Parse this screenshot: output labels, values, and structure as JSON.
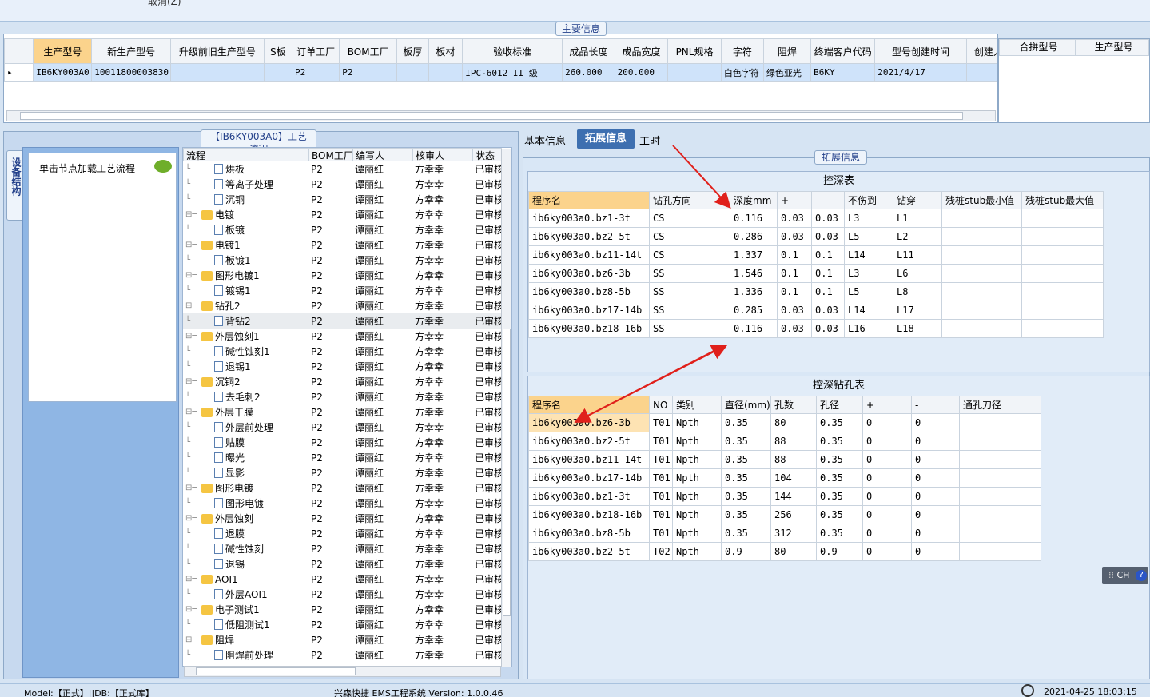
{
  "toolbar": {
    "cancel_label": "取消(Z)"
  },
  "main_info": {
    "title": "主要信息",
    "columns": [
      "生产型号",
      "新生产型号",
      "升级前旧生产型号",
      "S板",
      "订单工厂",
      "BOM工厂",
      "板厚",
      "板材",
      "验收标准",
      "成品长度",
      "成品宽度",
      "PNL规格",
      "字符",
      "阻焊",
      "终端客户代码",
      "型号创建时间",
      "创建人"
    ],
    "row": [
      "IB6KY003A0",
      "10011800003830",
      "",
      "",
      "P2",
      "P2",
      "",
      "",
      "IPC-6012 II 级",
      "260.000",
      "200.000",
      "",
      "白色字符",
      "绿色亚光",
      "B6KY",
      "2021/4/17",
      ""
    ]
  },
  "merge_panel": {
    "columns": [
      "合拼型号",
      "生产型号"
    ]
  },
  "flow_panel": {
    "title": "【IB6KY003A0】工艺流程",
    "side_tab": "设备结构",
    "hint": "单击节点加载工艺流程",
    "columns": [
      "流程",
      "BOM工厂",
      "编写人",
      "核审人",
      "状态"
    ],
    "rows": [
      {
        "name": "烘板",
        "level": 2,
        "bom": "P2",
        "writer": "谭丽红",
        "reviewer": "方幸幸",
        "status": "已审核"
      },
      {
        "name": "等离子处理",
        "level": 2,
        "bom": "P2",
        "writer": "谭丽红",
        "reviewer": "方幸幸",
        "status": "已审核"
      },
      {
        "name": "沉铜",
        "level": 2,
        "bom": "P2",
        "writer": "谭丽红",
        "reviewer": "方幸幸",
        "status": "已审核"
      },
      {
        "name": "电镀",
        "level": 1,
        "bom": "P2",
        "writer": "谭丽红",
        "reviewer": "方幸幸",
        "status": "已审核"
      },
      {
        "name": "板镀",
        "level": 2,
        "bom": "P2",
        "writer": "谭丽红",
        "reviewer": "方幸幸",
        "status": "已审核"
      },
      {
        "name": "电镀1",
        "level": 1,
        "bom": "P2",
        "writer": "谭丽红",
        "reviewer": "方幸幸",
        "status": "已审核"
      },
      {
        "name": "板镀1",
        "level": 2,
        "bom": "P2",
        "writer": "谭丽红",
        "reviewer": "方幸幸",
        "status": "已审核"
      },
      {
        "name": "图形电镀1",
        "level": 1,
        "bom": "P2",
        "writer": "谭丽红",
        "reviewer": "方幸幸",
        "status": "已审核"
      },
      {
        "name": "镀锡1",
        "level": 2,
        "bom": "P2",
        "writer": "谭丽红",
        "reviewer": "方幸幸",
        "status": "已审核"
      },
      {
        "name": "钻孔2",
        "level": 1,
        "bom": "P2",
        "writer": "谭丽红",
        "reviewer": "方幸幸",
        "status": "已审核"
      },
      {
        "name": "背钻2",
        "level": 2,
        "bom": "P2",
        "writer": "谭丽红",
        "reviewer": "方幸幸",
        "status": "已审核",
        "selected": true
      },
      {
        "name": "外层蚀刻1",
        "level": 1,
        "bom": "P2",
        "writer": "谭丽红",
        "reviewer": "方幸幸",
        "status": "已审核"
      },
      {
        "name": "碱性蚀刻1",
        "level": 2,
        "bom": "P2",
        "writer": "谭丽红",
        "reviewer": "方幸幸",
        "status": "已审核"
      },
      {
        "name": "退锡1",
        "level": 2,
        "bom": "P2",
        "writer": "谭丽红",
        "reviewer": "方幸幸",
        "status": "已审核"
      },
      {
        "name": "沉铜2",
        "level": 1,
        "bom": "P2",
        "writer": "谭丽红",
        "reviewer": "方幸幸",
        "status": "已审核"
      },
      {
        "name": "去毛刺2",
        "level": 2,
        "bom": "P2",
        "writer": "谭丽红",
        "reviewer": "方幸幸",
        "status": "已审核"
      },
      {
        "name": "外层干膜",
        "level": 1,
        "bom": "P2",
        "writer": "谭丽红",
        "reviewer": "方幸幸",
        "status": "已审核"
      },
      {
        "name": "外层前处理",
        "level": 2,
        "bom": "P2",
        "writer": "谭丽红",
        "reviewer": "方幸幸",
        "status": "已审核"
      },
      {
        "name": "贴膜",
        "level": 2,
        "bom": "P2",
        "writer": "谭丽红",
        "reviewer": "方幸幸",
        "status": "已审核"
      },
      {
        "name": "曝光",
        "level": 2,
        "bom": "P2",
        "writer": "谭丽红",
        "reviewer": "方幸幸",
        "status": "已审核"
      },
      {
        "name": "显影",
        "level": 2,
        "bom": "P2",
        "writer": "谭丽红",
        "reviewer": "方幸幸",
        "status": "已审核"
      },
      {
        "name": "图形电镀",
        "level": 1,
        "bom": "P2",
        "writer": "谭丽红",
        "reviewer": "方幸幸",
        "status": "已审核"
      },
      {
        "name": "图形电镀",
        "level": 2,
        "bom": "P2",
        "writer": "谭丽红",
        "reviewer": "方幸幸",
        "status": "已审核"
      },
      {
        "name": "外层蚀刻",
        "level": 1,
        "bom": "P2",
        "writer": "谭丽红",
        "reviewer": "方幸幸",
        "status": "已审核"
      },
      {
        "name": "退膜",
        "level": 2,
        "bom": "P2",
        "writer": "谭丽红",
        "reviewer": "方幸幸",
        "status": "已审核"
      },
      {
        "name": "碱性蚀刻",
        "level": 2,
        "bom": "P2",
        "writer": "谭丽红",
        "reviewer": "方幸幸",
        "status": "已审核"
      },
      {
        "name": "退锡",
        "level": 2,
        "bom": "P2",
        "writer": "谭丽红",
        "reviewer": "方幸幸",
        "status": "已审核"
      },
      {
        "name": "AOI1",
        "level": 1,
        "bom": "P2",
        "writer": "谭丽红",
        "reviewer": "方幸幸",
        "status": "已审核"
      },
      {
        "name": "外层AOI1",
        "level": 2,
        "bom": "P2",
        "writer": "谭丽红",
        "reviewer": "方幸幸",
        "status": "已审核"
      },
      {
        "name": "电子测试1",
        "level": 1,
        "bom": "P2",
        "writer": "谭丽红",
        "reviewer": "方幸幸",
        "status": "已审核"
      },
      {
        "name": "低阻测试1",
        "level": 2,
        "bom": "P2",
        "writer": "谭丽红",
        "reviewer": "方幸幸",
        "status": "已审核"
      },
      {
        "name": "阻焊",
        "level": 1,
        "bom": "P2",
        "writer": "谭丽红",
        "reviewer": "方幸幸",
        "status": "已审核"
      },
      {
        "name": "阻焊前处理",
        "level": 2,
        "bom": "P2",
        "writer": "谭丽红",
        "reviewer": "方幸幸",
        "status": "已审核"
      }
    ]
  },
  "tabs": [
    "基本信息",
    "拓展信息",
    "工时"
  ],
  "ext_info": {
    "title": "拓展信息",
    "depth_table": {
      "title": "控深表",
      "columns": [
        "程序名",
        "钻孔方向",
        "深度mm",
        "+",
        "-",
        "不伤到",
        "钻穿",
        "残桩stub最小值",
        "残桩stub最大值"
      ],
      "rows": [
        [
          "ib6ky003a0.bz1-3t",
          "CS",
          "0.116",
          "0.03",
          "0.03",
          "L3",
          "L1",
          "",
          ""
        ],
        [
          "ib6ky003a0.bz2-5t",
          "CS",
          "0.286",
          "0.03",
          "0.03",
          "L5",
          "L2",
          "",
          ""
        ],
        [
          "ib6ky003a0.bz11-14t",
          "CS",
          "1.337",
          "0.1",
          "0.1",
          "L14",
          "L11",
          "",
          ""
        ],
        [
          "ib6ky003a0.bz6-3b",
          "SS",
          "1.546",
          "0.1",
          "0.1",
          "L3",
          "L6",
          "",
          ""
        ],
        [
          "ib6ky003a0.bz8-5b",
          "SS",
          "1.336",
          "0.1",
          "0.1",
          "L5",
          "L8",
          "",
          ""
        ],
        [
          "ib6ky003a0.bz17-14b",
          "SS",
          "0.285",
          "0.03",
          "0.03",
          "L14",
          "L17",
          "",
          ""
        ],
        [
          "ib6ky003a0.bz18-16b",
          "SS",
          "0.116",
          "0.03",
          "0.03",
          "L16",
          "L18",
          "",
          ""
        ]
      ]
    },
    "hole_table": {
      "title": "控深钻孔表",
      "columns": [
        "程序名",
        "NO",
        "类别",
        "直径(mm)",
        "孔数",
        "孔径",
        "+",
        "-",
        "通孔刀径"
      ],
      "rows": [
        [
          "ib6ky003a0.bz6-3b",
          "T01",
          "Npth",
          "0.35",
          "80",
          "0.35",
          "0",
          "0",
          ""
        ],
        [
          "ib6ky003a0.bz2-5t",
          "T01",
          "Npth",
          "0.35",
          "88",
          "0.35",
          "0",
          "0",
          ""
        ],
        [
          "ib6ky003a0.bz11-14t",
          "T01",
          "Npth",
          "0.35",
          "88",
          "0.35",
          "0",
          "0",
          ""
        ],
        [
          "ib6ky003a0.bz17-14b",
          "T01",
          "Npth",
          "0.35",
          "104",
          "0.35",
          "0",
          "0",
          ""
        ],
        [
          "ib6ky003a0.bz1-3t",
          "T01",
          "Npth",
          "0.35",
          "144",
          "0.35",
          "0",
          "0",
          ""
        ],
        [
          "ib6ky003a0.bz18-16b",
          "T01",
          "Npth",
          "0.35",
          "256",
          "0.35",
          "0",
          "0",
          ""
        ],
        [
          "ib6ky003a0.bz8-5b",
          "T01",
          "Npth",
          "0.35",
          "312",
          "0.35",
          "0",
          "0",
          ""
        ],
        [
          "ib6ky003a0.bz2-5t",
          "T02",
          "Npth",
          "0.9",
          "80",
          "0.9",
          "0",
          "0",
          ""
        ]
      ]
    }
  },
  "ime": {
    "label": "CH"
  },
  "status_bar": {
    "left": "Model:【正式】||DB:【正式库】",
    "center": "兴森快捷 EMS工程系统 Version: 1.0.0.46",
    "datetime": "2021-04-25 18:03:15"
  },
  "colors": {
    "selected_header": "#fbd38c",
    "selected_row": "#cfe3fa",
    "arrow": "#e0201b",
    "folder": "#f5c542"
  }
}
